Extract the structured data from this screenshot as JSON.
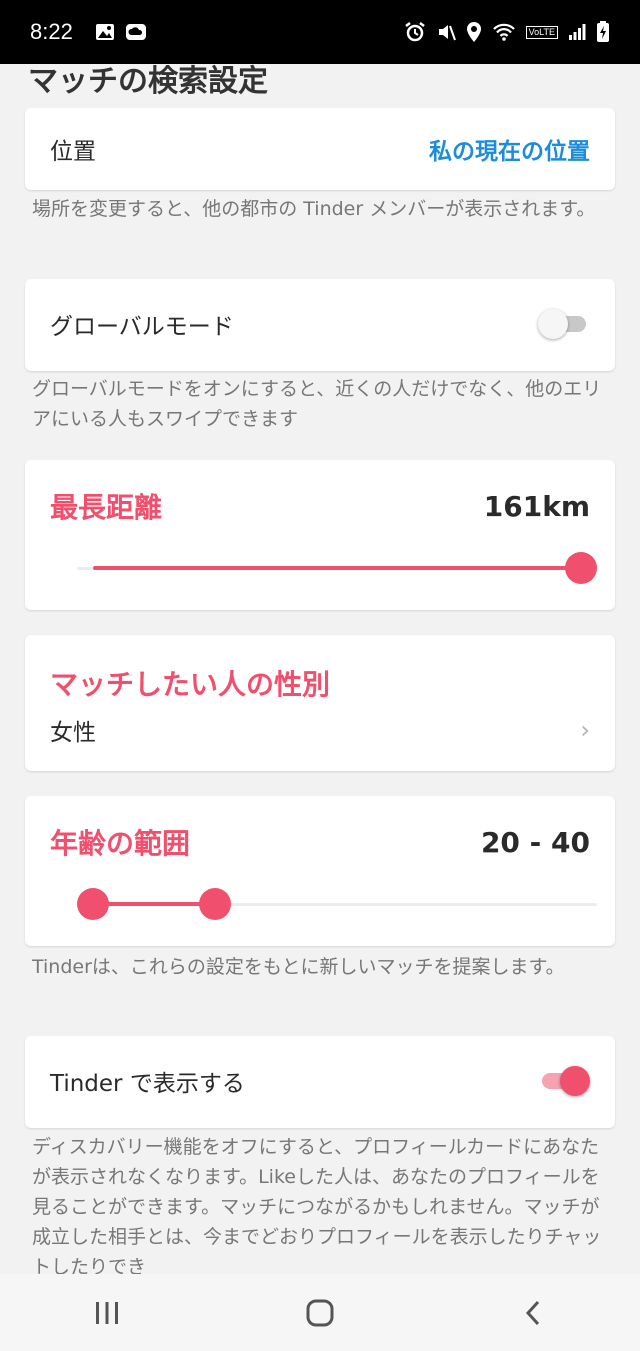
{
  "status_bar": {
    "time": "8:22",
    "icons_left": [
      "image-icon",
      "cloud-icon"
    ],
    "icons_right": [
      "alarm-icon",
      "mute-icon",
      "location-icon",
      "wifi-icon",
      "volte-icon",
      "signal-icon",
      "battery-icon"
    ],
    "volte_label": "VoLTE"
  },
  "page": {
    "title": "マッチの検索設定"
  },
  "location": {
    "label": "位置",
    "value": "私の現在の位置",
    "note": "場所を変更すると、他の都市の Tinder メンバーが表示されます。"
  },
  "global_mode": {
    "label": "グローバルモード",
    "enabled": false,
    "note": "グローバルモードをオンにすると、近くの人だけでなく、他のエリアにいる人もスワイプできます"
  },
  "max_distance": {
    "label": "最長距離",
    "value_text": "161km",
    "slider_fraction": 1.0
  },
  "gender": {
    "label": "マッチしたい人の性別",
    "value": "女性"
  },
  "age_range": {
    "label": "年齢の範囲",
    "value_text": "20 - 40",
    "low_fraction": 0.0,
    "high_fraction": 0.25,
    "note": "Tinderは、これらの設定をもとに新しいマッチを提案します。"
  },
  "show_on_tinder": {
    "label": "Tinder で表示する",
    "enabled": true,
    "note": "ディスカバリー機能をオフにすると、プロフィールカードにあなたが表示されなくなります。Likeした人は、あなたのプロフィールを見ることができます。マッチにつながるかもしれません。マッチが成立した相手とは、今までどおりプロフィールを表示したりチャットしたりでき"
  },
  "colors": {
    "accent": "#f0506e",
    "link": "#1c8cdb",
    "background": "#f2f2f2"
  },
  "nav_bar": {
    "buttons": [
      "recent-apps-icon",
      "home-icon",
      "back-icon"
    ]
  }
}
